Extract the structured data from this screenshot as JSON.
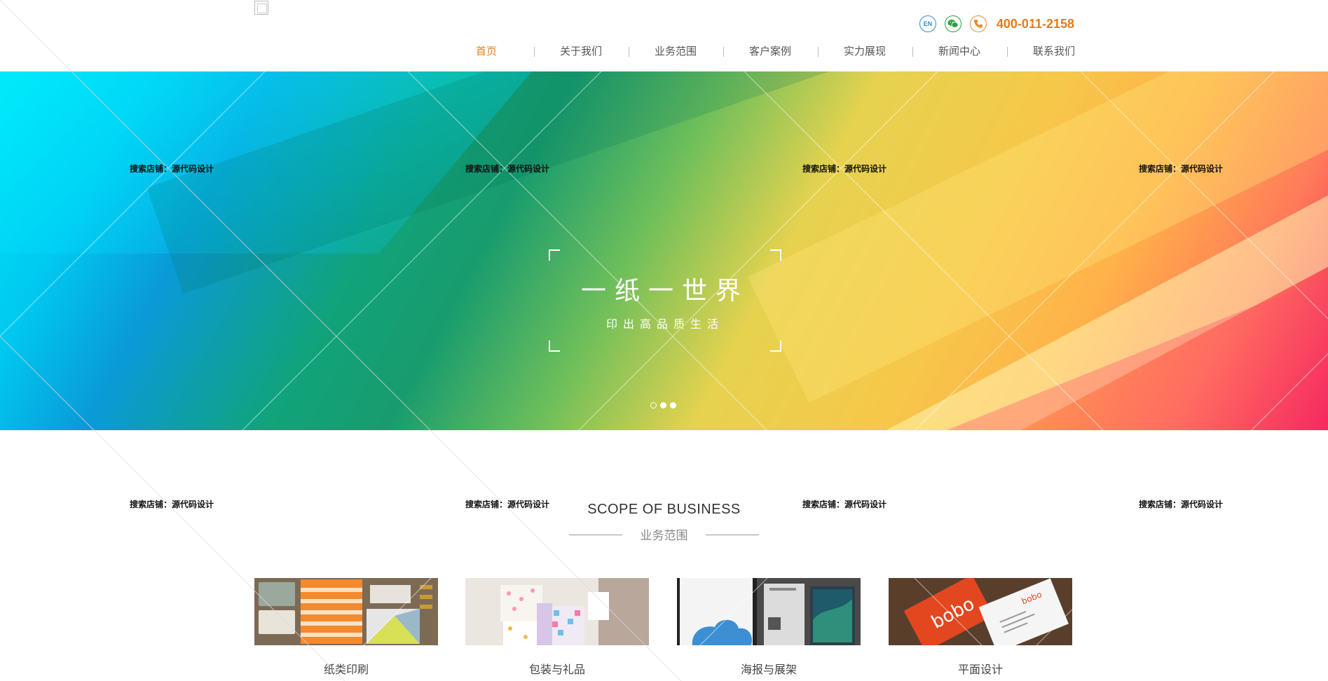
{
  "header": {
    "lang_badge": "EN",
    "phone": "400-011-2158",
    "nav": [
      {
        "label": "首页",
        "active": true
      },
      {
        "label": "关于我们",
        "active": false
      },
      {
        "label": "业务范围",
        "active": false
      },
      {
        "label": "客户案例",
        "active": false
      },
      {
        "label": "实力展现",
        "active": false
      },
      {
        "label": "新闻中心",
        "active": false
      },
      {
        "label": "联系我们",
        "active": false
      }
    ],
    "icons": [
      "logo-placeholder",
      "en-icon",
      "wechat-icon",
      "phone-icon"
    ]
  },
  "banner": {
    "title": "一纸一世界",
    "subtitle": "印出高品质生活",
    "slides": 3,
    "active_slide": 1
  },
  "watermark": {
    "text": "搜索店铺：源代码设计"
  },
  "scope": {
    "title_en": "SCOPE OF BUSINESS",
    "title_cn": "业务范围",
    "items": [
      {
        "label": "纸类印刷"
      },
      {
        "label": "包装与礼品"
      },
      {
        "label": "海报与展架"
      },
      {
        "label": "平面设计"
      }
    ]
  },
  "colors": {
    "accent": "#e07f1f",
    "phone": "#e77b1a",
    "en_icon": "#2a8fd8",
    "wechat_icon": "#2a9d3f"
  }
}
